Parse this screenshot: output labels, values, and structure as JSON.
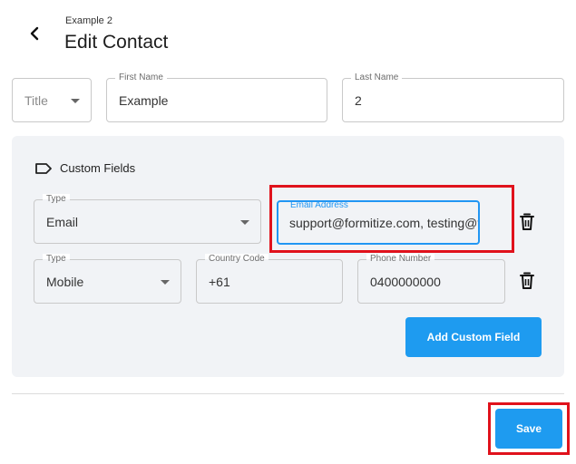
{
  "header": {
    "breadcrumb": "Example 2",
    "title": "Edit Contact",
    "back_icon": "chevron-left-icon"
  },
  "contact": {
    "title": {
      "placeholder": "Title",
      "value": ""
    },
    "first_name": {
      "label": "First Name",
      "value": "Example"
    },
    "last_name": {
      "label": "Last Name",
      "value": "2"
    }
  },
  "custom_fields": {
    "heading": "Custom Fields",
    "heading_icon": "tag-icon",
    "rows": [
      {
        "type_label": "Type",
        "type_value": "Email",
        "email_label": "Email Address",
        "email_value": "support@formitize.com, testing@formitize.com"
      },
      {
        "type_label": "Type",
        "type_value": "Mobile",
        "country_code_label": "Country Code",
        "country_code_value": "+61",
        "phone_label": "Phone Number",
        "phone_value": "0400000000"
      }
    ],
    "add_button": "Add Custom Field"
  },
  "actions": {
    "save": "Save"
  },
  "colors": {
    "accent": "#1e9bf0",
    "focus_border": "#2196f3",
    "highlight": "#e0121c",
    "panel": "#f1f3f6"
  }
}
